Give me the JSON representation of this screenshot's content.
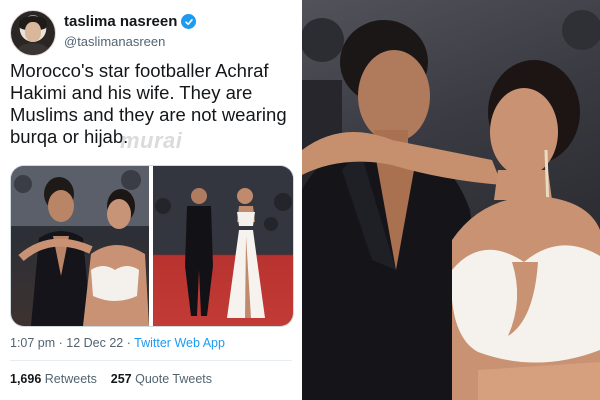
{
  "tweet": {
    "author_name": "taslima nasreen",
    "handle": "@taslimanasreen",
    "text_lines": [
      "Morocco's star footballer Achraf",
      "Hakimi and his wife. They are",
      "Muslims and they are not wearing",
      "burqa or hijab."
    ],
    "watermark": "murai",
    "time_date": "1:07 pm · 12 Dec 22 ·",
    "source_app": "Twitter Web App",
    "retweets_count": "1,696",
    "retweets_label": "Retweets",
    "quote_count": "257",
    "quote_label": "Quote Tweets"
  },
  "icons": {
    "verified": "verified-badge-icon"
  },
  "colors": {
    "accent": "#1d9bf0",
    "text": "#14171a",
    "secondary": "#536471",
    "red_carpet": "#c23b36"
  }
}
